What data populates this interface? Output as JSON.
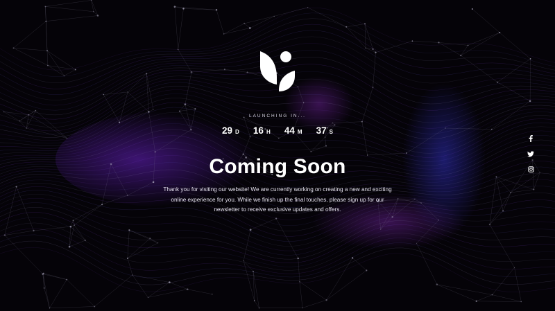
{
  "launching_text": "LAUNCHING IN...",
  "countdown": [
    {
      "value": "29",
      "unit": "D"
    },
    {
      "value": "16",
      "unit": "H"
    },
    {
      "value": "44",
      "unit": "M"
    },
    {
      "value": "37",
      "unit": "S"
    }
  ],
  "title": "Coming Soon",
  "description": "Thank you for visiting our website! We are currently working on creating a new and exciting online experience for you. While we finish up the final touches, please sign up for our newsletter to receive exclusive updates and offers.",
  "social": [
    "facebook-icon",
    "twitter-icon",
    "instagram-icon"
  ],
  "colors": {
    "background": "#050308",
    "accent_purple": "#7b2fd0",
    "accent_blue": "#3b3bd6",
    "text": "#ffffff"
  }
}
